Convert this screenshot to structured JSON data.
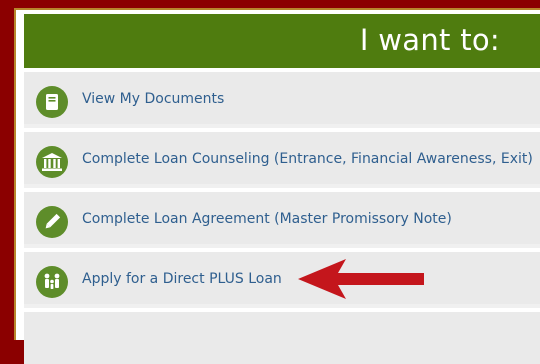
{
  "header": {
    "title": "I want to:"
  },
  "menu": {
    "items": [
      {
        "label": "View My Documents",
        "icon": "document-icon"
      },
      {
        "label": "Complete Loan Counseling (Entrance, Financial Awareness, Exit)",
        "icon": "bank-icon"
      },
      {
        "label": "Complete Loan Agreement (Master Promissory Note)",
        "icon": "pencil-icon"
      },
      {
        "label": "Apply for a Direct PLUS Loan",
        "icon": "family-icon"
      }
    ]
  },
  "annotation": {
    "icon": "red-arrow-icon",
    "color": "#c4161c"
  },
  "colors": {
    "header": "#4f7c0f",
    "icon_bg": "#5e8d2a",
    "link": "#2f5f8f",
    "page_bg": "#8b0000"
  }
}
